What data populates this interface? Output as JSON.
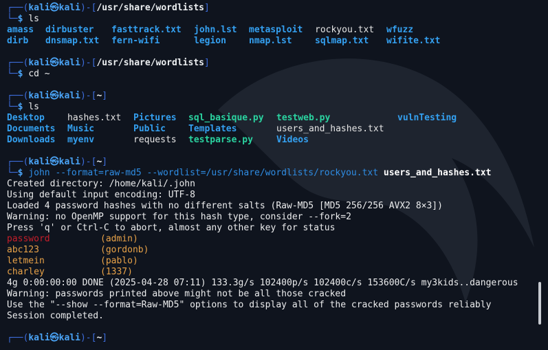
{
  "prompt": {
    "corner_top": "┌──(",
    "corner_bottom": "└─",
    "user": "kali",
    "skull": "㉿",
    "host": "kali",
    "sep": ")-[",
    "close": "]",
    "dollar": "$"
  },
  "blocks": [
    {
      "path": "/usr/share/wordlists",
      "command": "ls"
    },
    {
      "path": "/usr/share/wordlists",
      "command": "cd ~"
    },
    {
      "path": "~",
      "command": "ls"
    },
    {
      "path": "~",
      "command_prefix": "john --format=raw-md5 --wordlist=/usr/share/wordlists/rockyou.txt",
      "command_arg": "users_and_hashes.txt"
    },
    {
      "path": "~"
    }
  ],
  "ls1": {
    "row1": [
      "amass",
      "dirbuster",
      "fasttrack.txt",
      "john.lst",
      "metasploit",
      "rockyou.txt",
      "wfuzz"
    ],
    "row2": [
      "dirb",
      "dnsmap.txt",
      "fern-wifi",
      "legion",
      "nmap.lst",
      "sqlmap.txt",
      "wifite.txt"
    ]
  },
  "ls2": {
    "row1": [
      "Desktop",
      "hashes.txt",
      "Pictures",
      "sql_basique.py",
      "testweb.py",
      "vulnTesting"
    ],
    "row2": [
      "Documents",
      "Music",
      "Public",
      "Templates",
      "users_and_hashes.txt"
    ],
    "row3": [
      "Downloads",
      "myenv",
      "requests",
      "testparse.py",
      "Videos"
    ]
  },
  "john_output": {
    "line1": "Created directory: /home/kali/.john",
    "line2": "Using default input encoding: UTF-8",
    "line3": "Loaded 4 password hashes with no different salts (Raw-MD5 [MD5 256/256 AVX2 8×3])",
    "line4": "Warning: no OpenMP support for this hash type, consider --fork=2",
    "line5": "Press 'q' or Ctrl-C to abort, almost any other key for status",
    "cracked": [
      {
        "password": "password",
        "user": "(admin)"
      },
      {
        "password": "abc123",
        "user": "(gordonb)"
      },
      {
        "password": "letmein",
        "user": "(pablo)"
      },
      {
        "password": "charley",
        "user": "(1337)"
      }
    ],
    "status": "4g 0:00:00:00 DONE (2025-04-28 07:11) 133.3g/s 102400p/s 102400c/s 153600C/s my3kids..dangerous",
    "warn": "Warning: passwords printed above might not be all those cracked",
    "use": "Use the \"--show --format=Raw-MD5\" options to display all of the cracked passwords reliably",
    "done": "Session completed."
  }
}
